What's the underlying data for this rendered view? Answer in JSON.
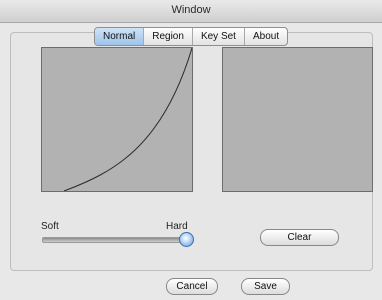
{
  "window": {
    "title": "Window"
  },
  "tabs": [
    {
      "label": "Normal",
      "active": true
    },
    {
      "label": "Region",
      "active": false
    },
    {
      "label": "Key Set",
      "active": false
    },
    {
      "label": "About",
      "active": false
    }
  ],
  "slider": {
    "min_label": "Soft",
    "max_label": "Hard",
    "value_fraction": 1.0
  },
  "buttons": {
    "clear": "Clear",
    "cancel": "Cancel",
    "save": "Save"
  },
  "colors": {
    "panel": "#b2b2b2",
    "tab_active": "#9ec3ea",
    "slider_thumb": "#5b96d8"
  }
}
